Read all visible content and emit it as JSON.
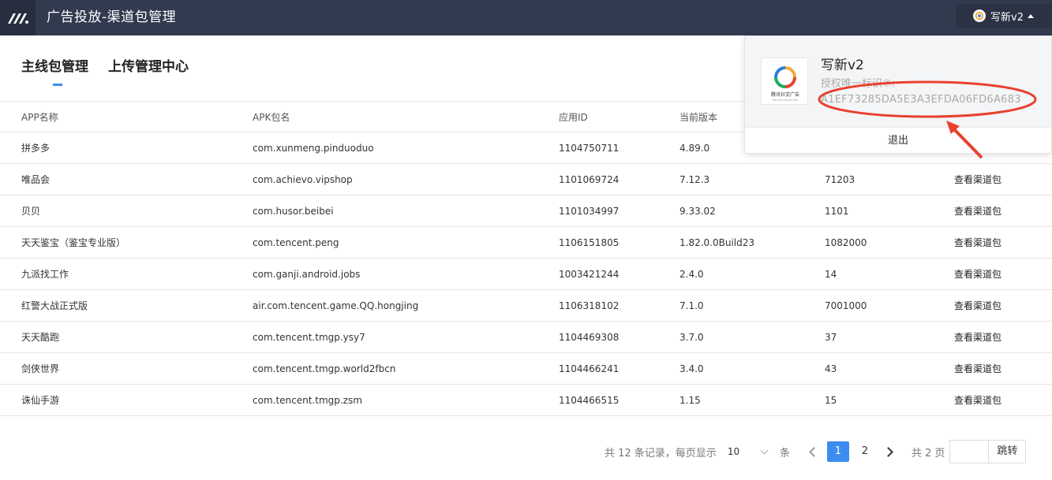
{
  "header": {
    "title": "广告投放-渠道包管理",
    "user_name": "写新v2"
  },
  "tabs": [
    {
      "label": "主线包管理",
      "active": true
    },
    {
      "label": "上传管理中心",
      "active": false
    }
  ],
  "table": {
    "columns": [
      "APP名称",
      "APK包名",
      "应用ID",
      "当前版本",
      "",
      ""
    ],
    "rows": [
      {
        "name": "拼多多",
        "pkg": "com.xunmeng.pinduoduo",
        "app_id": "1104750711",
        "version": "4.89.0",
        "code": "",
        "action": ""
      },
      {
        "name": "唯品会",
        "pkg": "com.achievo.vipshop",
        "app_id": "1101069724",
        "version": "7.12.3",
        "code": "71203",
        "action": "查看渠道包"
      },
      {
        "name": "贝贝",
        "pkg": "com.husor.beibei",
        "app_id": "1101034997",
        "version": "9.33.02",
        "code": "1101",
        "action": "查看渠道包"
      },
      {
        "name": "天天鉴宝（鉴宝专业版）",
        "pkg": "com.tencent.peng",
        "app_id": "1106151805",
        "version": "1.82.0.0Build23",
        "code": "1082000",
        "action": "查看渠道包"
      },
      {
        "name": "九派找工作",
        "pkg": "com.ganji.android.jobs",
        "app_id": "1003421244",
        "version": "2.4.0",
        "code": "14",
        "action": "查看渠道包"
      },
      {
        "name": "红警大战正式版",
        "pkg": "air.com.tencent.game.QQ.hongjing",
        "app_id": "1106318102",
        "version": "7.1.0",
        "code": "7001000",
        "action": "查看渠道包"
      },
      {
        "name": "天天酷跑",
        "pkg": "com.tencent.tmgp.ysy7",
        "app_id": "1104469308",
        "version": "3.7.0",
        "code": "37",
        "action": "查看渠道包"
      },
      {
        "name": "剑侠世界",
        "pkg": "com.tencent.tmgp.world2fbcn",
        "app_id": "1104466241",
        "version": "3.4.0",
        "code": "43",
        "action": "查看渠道包"
      },
      {
        "name": "诛仙手游",
        "pkg": "com.tencent.tmgp.zsm",
        "app_id": "1104466515",
        "version": "1.15",
        "code": "15",
        "action": "查看渠道包"
      }
    ]
  },
  "pagination": {
    "total_text": "共 12 条记录，每页显示",
    "page_size": "10",
    "unit": "条",
    "pages": [
      "1",
      "2"
    ],
    "current": "1",
    "total_pages_text": "共 2 页",
    "goto_label": "跳转"
  },
  "popup": {
    "name": "写新v2",
    "auth_label": "授权唯一标识⑦:",
    "auth_id": "A1EF73285DA5E3A3EFDA06FD6A683",
    "logout_label": "退出",
    "logo_caption": "腾讯社交广告",
    "logo_subcaption": "Tencent Social Ads"
  },
  "annotation_color": "#e8412f",
  "accent_color": "#3d8cf0"
}
